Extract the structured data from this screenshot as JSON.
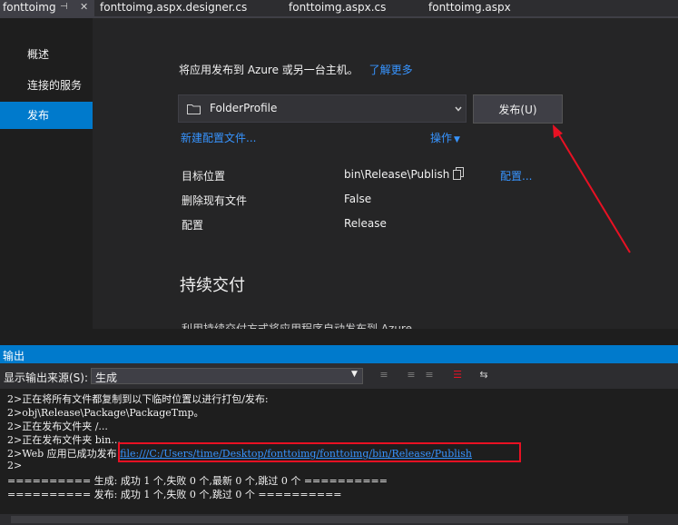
{
  "tabs": [
    {
      "label": "fonttoimg",
      "active": true
    },
    {
      "label": "fonttoimg.aspx.designer.cs"
    },
    {
      "label": "fonttoimg.aspx.cs"
    },
    {
      "label": "fonttoimg.aspx"
    }
  ],
  "nav": {
    "items": [
      "概述",
      "连接的服务",
      "发布"
    ],
    "active_index": 2
  },
  "publish": {
    "intro": "将应用发布到 Azure 或另一台主机。",
    "learn_more": "了解更多",
    "profile_value": "FolderProfile",
    "publish_button": "发布(U)",
    "new_profile_link": "新建配置文件...",
    "actions_link": "操作",
    "rows": [
      {
        "label": "目标位置",
        "value": "bin\\Release\\Publish",
        "action": "配置..."
      },
      {
        "label": "删除现有文件",
        "value": "False"
      },
      {
        "label": "配置",
        "value": "Release"
      }
    ],
    "cd_title": "持续交付",
    "cd_desc": "利用持续交付方式将应用程序自动发布到 Azure"
  },
  "output": {
    "title": "输出",
    "source_label": "显示输出来源(S):",
    "source_value": "生成",
    "lines": [
      "2>正在将所有文件都复制到以下临时位置以进行打包/发布:",
      "2>obj\\Release\\Package\\PackageTmp。",
      "2>正在发布文件夹 /...",
      "2>正在发布文件夹 bin..."
    ],
    "success_prefix": "2>Web 应用已成功发布",
    "success_link": "file:///C:/Users/time/Desktop/fonttoimg/fonttoimg/bin/Release/Publish",
    "prompt_line": "2>",
    "summary_build": "========== 生成: 成功 1 个,失败 0 个,最新 0 个,跳过 0 个 ==========",
    "summary_publish": "========== 发布: 成功 1 个,失败 0 个,跳过 0 个 =========="
  },
  "colors": {
    "accent": "#007acc",
    "link": "#3794ff",
    "annotation": "#e81123"
  }
}
